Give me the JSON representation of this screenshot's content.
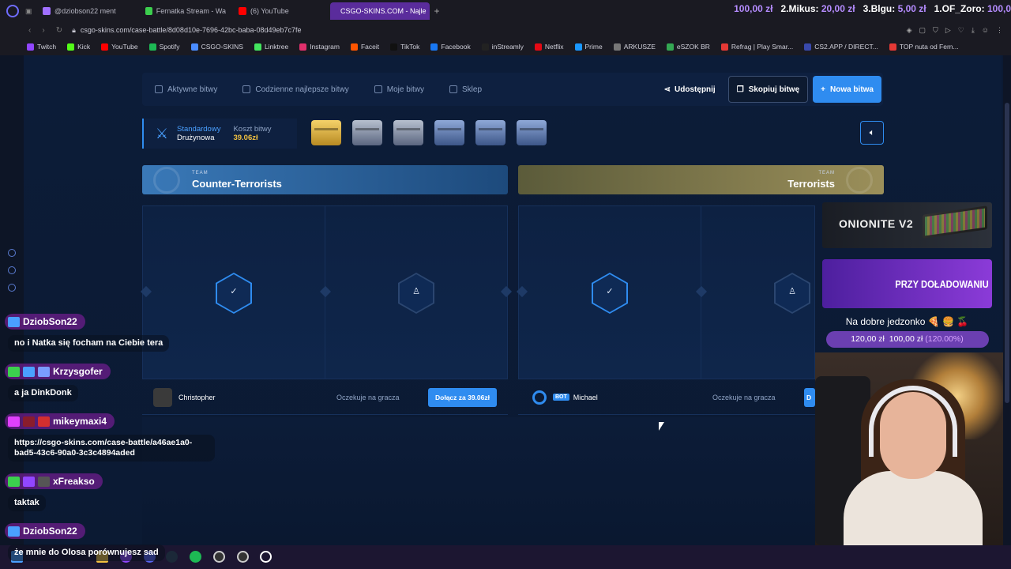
{
  "browser": {
    "tabs": [
      {
        "label": "@dziobson22 ment",
        "color": "#a070ff"
      },
      {
        "label": "Fernatka Stream - Wa",
        "color": "#3ccf4e"
      },
      {
        "label": "(6) YouTube",
        "color": "#ff0000"
      },
      {
        "label": "CSGO-SKINS.COM - Najle",
        "color": "#8a6cff",
        "active": true
      }
    ],
    "url": "csgo-skins.com/case-battle/8d08d10e-7696-42bc-baba-08d49eb7c7fe",
    "bookmarks": [
      {
        "label": "Twitch",
        "color": "#9146ff"
      },
      {
        "label": "Kick",
        "color": "#53fc18"
      },
      {
        "label": "YouTube",
        "color": "#ff0000"
      },
      {
        "label": "Spotify",
        "color": "#1db954"
      },
      {
        "label": "CSGO-SKINS",
        "color": "#4a8cff"
      },
      {
        "label": "Linktree",
        "color": "#43e55e"
      },
      {
        "label": "Instagram",
        "color": "#e1306c"
      },
      {
        "label": "Faceit",
        "color": "#ff5500"
      },
      {
        "label": "TikTok",
        "color": "#111111"
      },
      {
        "label": "Facebook",
        "color": "#1877f2"
      },
      {
        "label": "inStreamly",
        "color": "#222222"
      },
      {
        "label": "Netflix",
        "color": "#e50914"
      },
      {
        "label": "Prime",
        "color": "#1a98ff"
      },
      {
        "label": "ARKUSZE",
        "color": "#777777"
      },
      {
        "label": "eSZOK BR",
        "color": "#34a853"
      },
      {
        "label": "Refrag | Play Smar...",
        "color": "#e53935"
      },
      {
        "label": "CS2.APP / DIRECT...",
        "color": "#3949ab"
      },
      {
        "label": "TOP nuta od Fern...",
        "color": "#e53935"
      }
    ]
  },
  "donors": [
    {
      "text": "100,00 zł"
    },
    {
      "name": "2.Mikus:",
      "amount": "20,00 zł"
    },
    {
      "name": "3.Blgu:",
      "amount": "5,00 zł"
    },
    {
      "name": "1.OF_Zoro:",
      "amount": "100,0"
    }
  ],
  "menu": {
    "items": [
      "Aktywne bitwy",
      "Codzienne najlepsze bitwy",
      "Moje bitwy",
      "Sklep"
    ],
    "share": "Udostępnij",
    "copy": "Skopiuj bitwę",
    "new": "Nowa bitwa"
  },
  "battle": {
    "mode_line1": "Standardowy",
    "mode_line2": "Drużynowa",
    "cost_label": "Koszt bitwy",
    "cost_value": "39.06zł",
    "cases": [
      "gold",
      "steel",
      "steel",
      "blue",
      "blue",
      "blue"
    ]
  },
  "teams": {
    "ct": {
      "small": "TEAM",
      "name": "Counter-Terrorists"
    },
    "t": {
      "small": "TEAM",
      "name": "Terrorists"
    }
  },
  "players": {
    "a": {
      "name": "Christopher",
      "waiting": "Oczekuje na gracza",
      "join": "Dołącz za 39.06zł"
    },
    "b": {
      "bot_tag": "BOT",
      "name": "Michael",
      "waiting": "Oczekuje na gracza",
      "join": "D"
    }
  },
  "ads": {
    "ad1": "ONIONITE V2",
    "ad2": "PRZY DOŁADOWANIU"
  },
  "goal": {
    "label": "Na dobre jedzonko 🍕 🍔 🍒",
    "current": "120,00 zł",
    "target": "100,00 zł",
    "percent": "(120.00%)"
  },
  "chat": [
    {
      "user": "DziobSon22",
      "text": "no i Natka się focham na Ciebie tera",
      "user_color": "#ffffff"
    },
    {
      "user": "Krzysgofer",
      "text": "a ja DinkDonk",
      "user_color": "#ffffff"
    },
    {
      "user": "mikeymaxi4",
      "text": "https://csgo-skins.com/case-battle/a46ae1a0-bad5-43c6-90a0-3c3c4894aded",
      "user_color": "#ffffff"
    },
    {
      "user": "xFreakso",
      "text": "taktak",
      "user_color": "#ffffff"
    },
    {
      "user": "DziobSon22",
      "text": "że mnie do Olosa porównujesz sad",
      "user_color": "#ffffff"
    }
  ]
}
